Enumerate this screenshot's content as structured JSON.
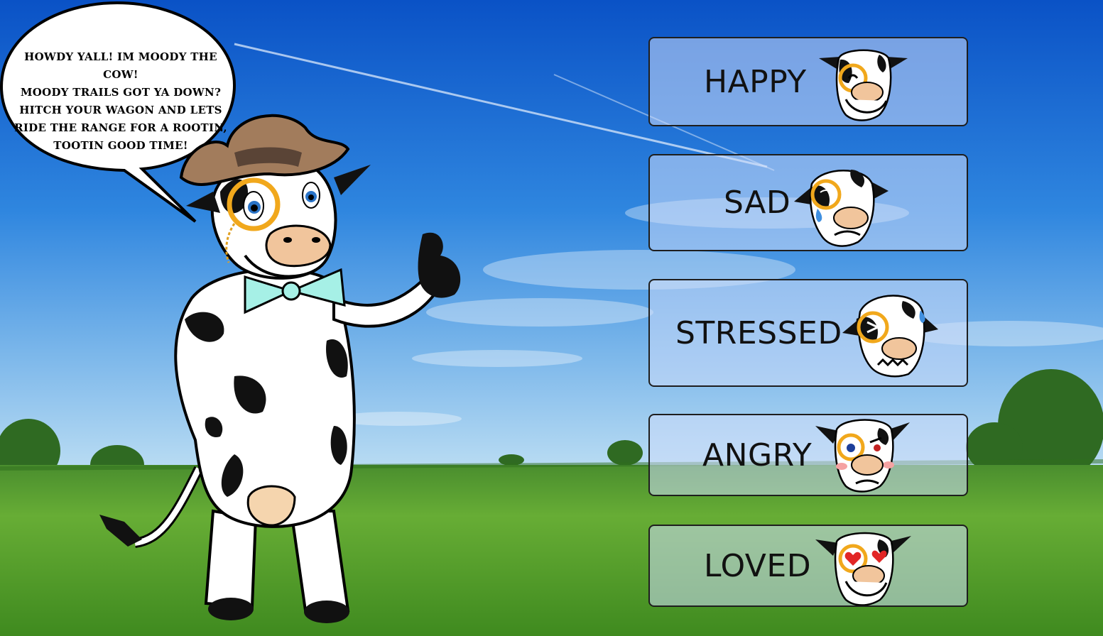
{
  "speech_bubble": {
    "lines": [
      "HOWDY YALL! IM MOODY THE COW!",
      "MOODY TRAILS GOT YA DOWN?",
      "HITCH YOUR WAGON AND LETS",
      "RIDE THE RANGE FOR A ROOTIN,",
      "TOOTIN GOOD TIME!"
    ]
  },
  "moods": [
    {
      "label": "HAPPY",
      "icon": "happy-cow-face-icon"
    },
    {
      "label": "SAD",
      "icon": "sad-cow-face-icon"
    },
    {
      "label": "STRESSED",
      "icon": "stressed-cow-face-icon"
    },
    {
      "label": "ANGRY",
      "icon": "angry-cow-face-icon"
    },
    {
      "label": "LOVED",
      "icon": "loved-cow-face-icon"
    }
  ],
  "colors": {
    "sky_top": "#0d5bd0",
    "sky_bottom": "#8fc4ee",
    "grass": "#4e9a2a",
    "monocle": "#f1a81c",
    "bowtie": "#a6f0e6",
    "hat": "#a27c5c",
    "snout": "#f1c59c"
  }
}
